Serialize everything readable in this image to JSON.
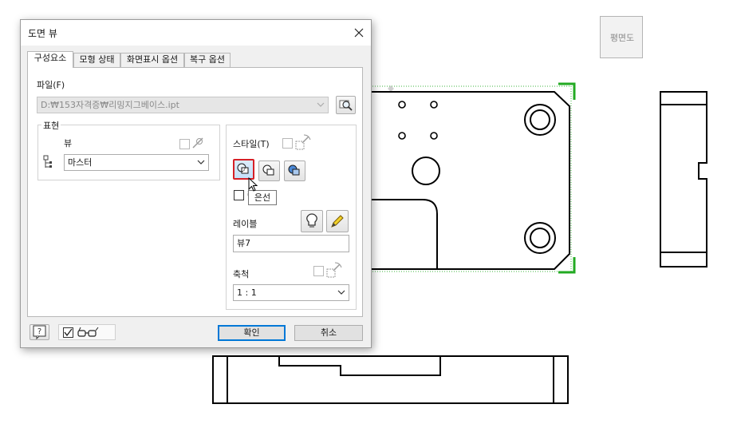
{
  "view_label": "평면도",
  "dialog": {
    "title": "도면 뷰",
    "tabs": [
      {
        "label": "구성요소",
        "active": true
      },
      {
        "label": "모형 상태",
        "active": false
      },
      {
        "label": "화면표시 옵션",
        "active": false
      },
      {
        "label": "복구 옵션",
        "active": false
      }
    ],
    "file": {
      "label": "파일(F)",
      "value": "D:₩153자격증₩리밍지그베이스.ipt"
    },
    "representation": {
      "group_label": "표현",
      "view_label": "뷰",
      "view_value": "마스터"
    },
    "style": {
      "label": "스타일(T)",
      "buttons": [
        "hidden-line-style",
        "hidden-line-removed-style",
        "shaded-style"
      ],
      "selected": "hidden-line-style"
    },
    "tooltip": "은선",
    "label_section": {
      "label": "레이블",
      "value": "뷰7"
    },
    "scale": {
      "label": "축척",
      "value": "1 : 1"
    },
    "ok_label": "확인",
    "cancel_label": "취소"
  },
  "colors": {
    "dialog_bg": "#f0f0f0",
    "selected_outline": "#d62027",
    "default_button_border": "#0078d7",
    "view_boundary": "#22aa22",
    "drawing_line": "#000000"
  }
}
